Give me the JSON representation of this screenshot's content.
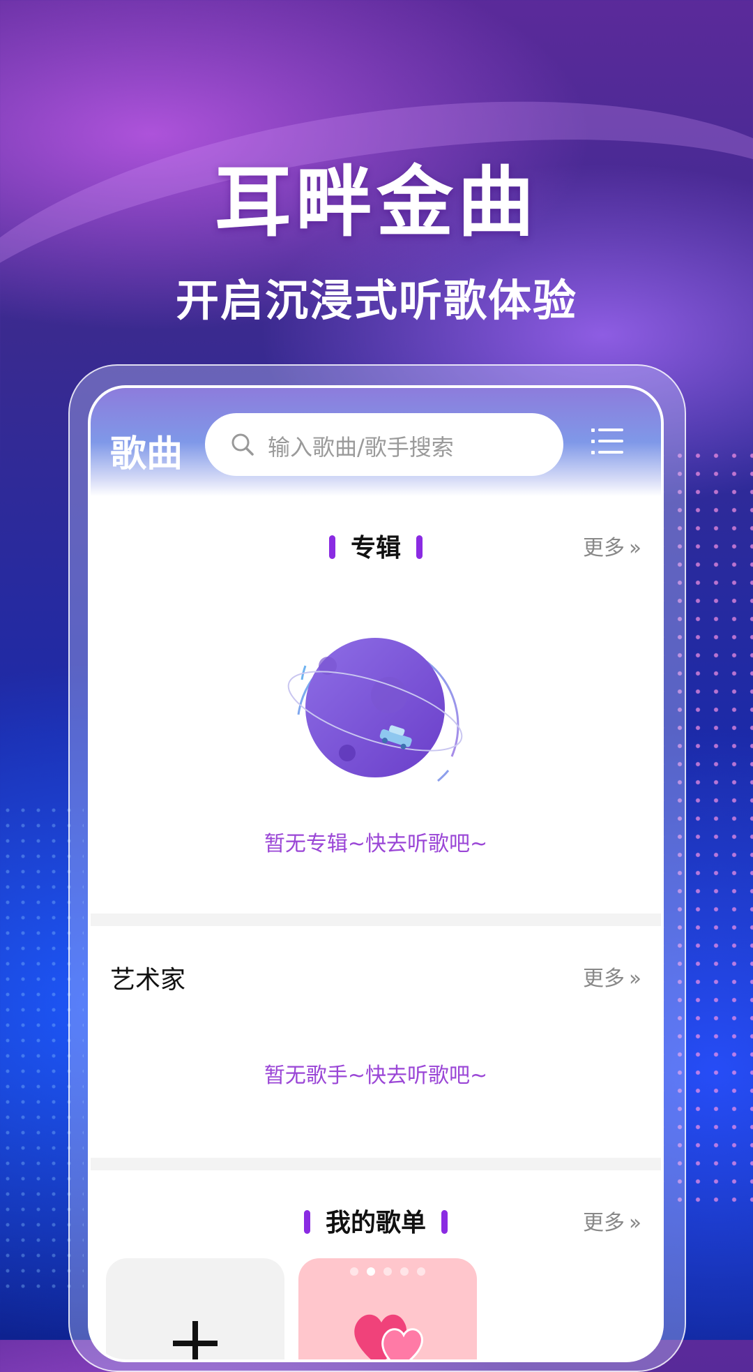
{
  "hero": {
    "title": "耳畔金曲",
    "subtitle": "开启沉浸式听歌体验"
  },
  "header": {
    "title": "歌曲",
    "search_placeholder": "输入歌曲/歌手搜索"
  },
  "sections": {
    "albums": {
      "title": "专辑",
      "more": "更多",
      "empty": "暂无专辑~快去听歌吧~"
    },
    "artists": {
      "title": "艺术家",
      "more": "更多",
      "empty": "暂无歌手~快去听歌吧~"
    },
    "playlists": {
      "title": "我的歌单",
      "more": "更多",
      "page_dots": 5,
      "active_dot": 2
    }
  },
  "icons": [
    "search-icon",
    "menu-icon",
    "chevron-double-right-icon",
    "planet-illustration",
    "plus-icon",
    "heart-icon"
  ],
  "colors": {
    "accent": "#8a2be2",
    "empty_text": "#9a46d6",
    "fav_card": "#ffc6cc"
  }
}
